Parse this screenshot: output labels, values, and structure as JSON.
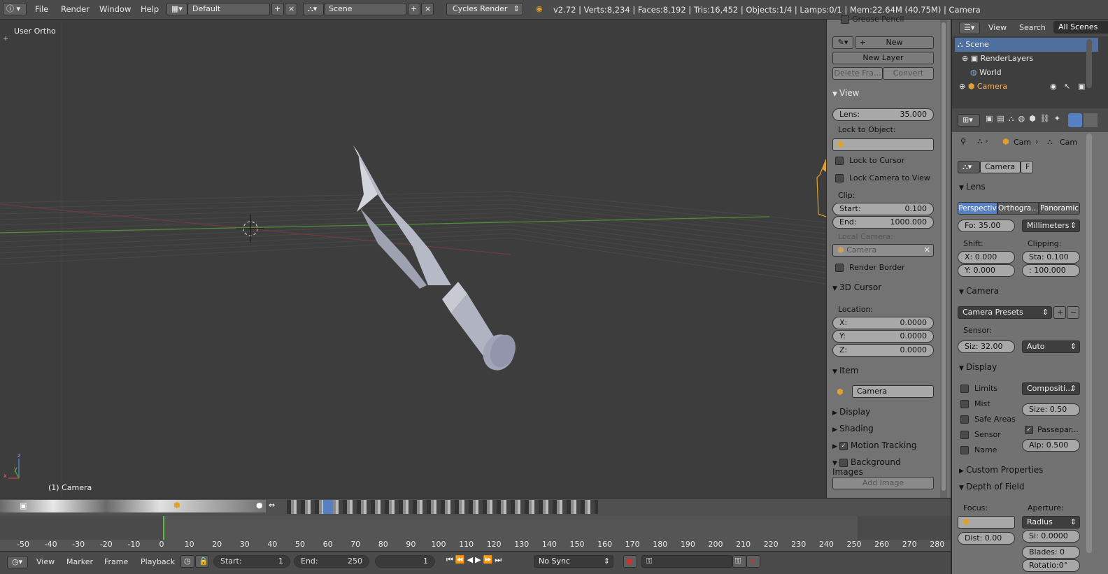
{
  "topbar": {
    "menus": [
      "File",
      "Render",
      "Window",
      "Help"
    ],
    "layout_name": "Default",
    "scene_name": "Scene",
    "render_engine": "Cycles Render",
    "status": "v2.72 | Verts:8,234 | Faces:8,192 | Tris:16,452 | Objects:1/4 | Lamps:0/1 | Mem:22.64M (40.75M) | Camera"
  },
  "viewport": {
    "view_label": "User Ortho",
    "object_label": "(1) Camera",
    "axis_z": "z",
    "axis_y": "y",
    "axis_x": "x"
  },
  "npanel": {
    "grease_pencil": "Grease Pencil",
    "new": "New",
    "new_layer": "New Layer",
    "delete_frame": "Delete Fra...",
    "convert": "Convert",
    "view_header": "View",
    "lens_label": "Lens:",
    "lens_value": "35.000",
    "lock_to_object": "Lock to Object:",
    "lock_to_cursor": "Lock to Cursor",
    "lock_camera_to_view": "Lock Camera to View",
    "clip": "Clip:",
    "start_label": "Start:",
    "start_value": "0.100",
    "end_label": "End:",
    "end_value": "1000.000",
    "local_camera": "Local Camera:",
    "local_camera_value": "Camera",
    "render_border": "Render Border",
    "cursor_header": "3D Cursor",
    "location": "Location:",
    "x_label": "X:",
    "x_value": "0.0000",
    "y_label": "Y:",
    "y_value": "0.0000",
    "z_label": "Z:",
    "z_value": "0.0000",
    "item_header": "Item",
    "item_name": "Camera",
    "display": "Display",
    "shading": "Shading",
    "motion_tracking": "Motion Tracking",
    "background_images": "Background Images",
    "add_image": "Add Image"
  },
  "outliner": {
    "view": "View",
    "search": "Search",
    "filter": "All Scenes",
    "rows": [
      "Scene",
      "RenderLayers",
      "World",
      "Camera"
    ]
  },
  "props": {
    "breadcrumb_obj": "Cam",
    "breadcrumb_data": "Cam",
    "datablock": "Camera",
    "fake_user": "F",
    "lens_header": "Lens",
    "tab_persp": "Perspectiv",
    "tab_ortho": "Orthogra...",
    "tab_pano": "Panoramic",
    "focal": "Fo: 35.00",
    "units": "Millimeters",
    "shift": "Shift:",
    "clipping": "Clipping:",
    "shift_x": "X:  0.000",
    "shift_y": "Y:  0.000",
    "clip_start": "Sta: 0.100",
    "clip_end": ": 100.000",
    "camera_header": "Camera",
    "presets": "Camera Presets",
    "sensor": "Sensor:",
    "sensor_size": "Siz: 32.00",
    "sensor_fit": "Auto",
    "display_header": "Display",
    "limits": "Limits",
    "mist": "Mist",
    "safe_areas": "Safe Areas",
    "sensor_chk": "Sensor",
    "name_chk": "Name",
    "composition": "Compositi...",
    "size": "Size:  0.50",
    "passepartout": "Passepar...",
    "alpha": "Alp: 0.500",
    "custom_props": "Custom Properties",
    "dof_header": "Depth of Field",
    "focus": "Focus:",
    "aperture": "Aperture:",
    "radius": "Radius",
    "dist": "Dist:  0.00",
    "size_ap": "Si: 0.0000",
    "blades": "Blades:   0",
    "rotation": "Rotatio:0°"
  },
  "timeline": {
    "ticks": [
      "-50",
      "-40",
      "-30",
      "-20",
      "-10",
      "0",
      "10",
      "20",
      "30",
      "40",
      "50",
      "60",
      "70",
      "80",
      "90",
      "100",
      "110",
      "120",
      "130",
      "140",
      "150",
      "160",
      "170",
      "180",
      "190",
      "200",
      "210",
      "220",
      "230",
      "240",
      "250",
      "260",
      "270",
      "280"
    ],
    "view": "View",
    "marker": "Marker",
    "frame": "Frame",
    "playback": "Playback",
    "start_label": "Start:",
    "start_value": "1",
    "end_label": "End:",
    "end_value": "250",
    "current": "1",
    "sync": "No Sync"
  },
  "colors": {
    "accent": "#5680c2",
    "x_axis": "#a84040",
    "y_axis": "#5a9a3a",
    "camera_orange": "#e0a030"
  }
}
